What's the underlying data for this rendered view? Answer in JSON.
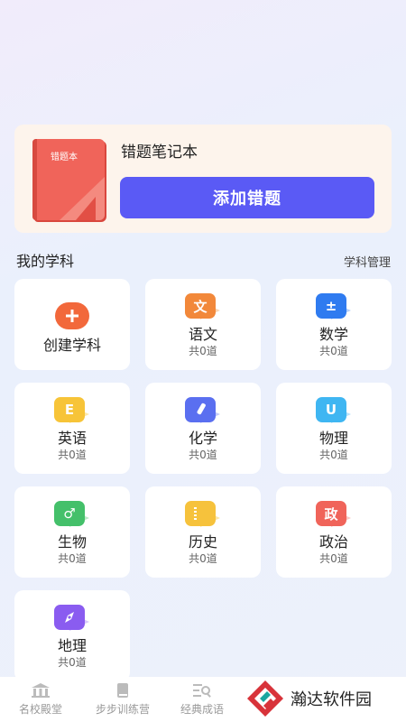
{
  "notebook": {
    "cover_title": "错题本",
    "title": "错题笔记本",
    "add_button": "添加错题"
  },
  "section": {
    "title": "我的学科",
    "manage": "学科管理"
  },
  "create": {
    "label": "创建学科",
    "icon": "plus-icon"
  },
  "subjects": [
    {
      "name": "语文",
      "count": "共0道",
      "glyph": "文",
      "color": "#f2883a",
      "tail": "#fbd6b4",
      "icon": "chinese-icon"
    },
    {
      "name": "数学",
      "count": "共0道",
      "glyph": "±",
      "color": "#2f7bf0",
      "tail": "#b8d2fb",
      "icon": "math-icon"
    },
    {
      "name": "英语",
      "count": "共0道",
      "glyph": "E",
      "color": "#f7c438",
      "tail": "#fde8a9",
      "icon": "english-icon"
    },
    {
      "name": "化学",
      "count": "共0道",
      "glyph": "",
      "color": "#5a6ff0",
      "tail": "#c4cbfa",
      "icon": "chemistry-icon"
    },
    {
      "name": "物理",
      "count": "共0道",
      "glyph": "U",
      "color": "#3fb6f2",
      "tail": "#b7e3fb",
      "icon": "physics-icon"
    },
    {
      "name": "生物",
      "count": "共0道",
      "glyph": "♂",
      "color": "#44c06a",
      "tail": "#bbe9c7",
      "icon": "biology-icon"
    },
    {
      "name": "历史",
      "count": "共0道",
      "glyph": "",
      "color": "#f6c23c",
      "tail": "#fde6a6",
      "icon": "history-icon"
    },
    {
      "name": "政治",
      "count": "共0道",
      "glyph": "政",
      "color": "#f0645a",
      "tail": "#fbc8c3",
      "icon": "politics-icon"
    },
    {
      "name": "地理",
      "count": "共0道",
      "glyph": "",
      "color": "#8a5cf0",
      "tail": "#d8c8fb",
      "icon": "geography-icon"
    }
  ],
  "tabs": [
    {
      "label": "名校殿堂",
      "icon": "school-icon"
    },
    {
      "label": "步步训练营",
      "icon": "book-icon"
    },
    {
      "label": "经典成语",
      "icon": "search-list-icon"
    }
  ],
  "watermark": {
    "text": "瀚达软件园"
  }
}
